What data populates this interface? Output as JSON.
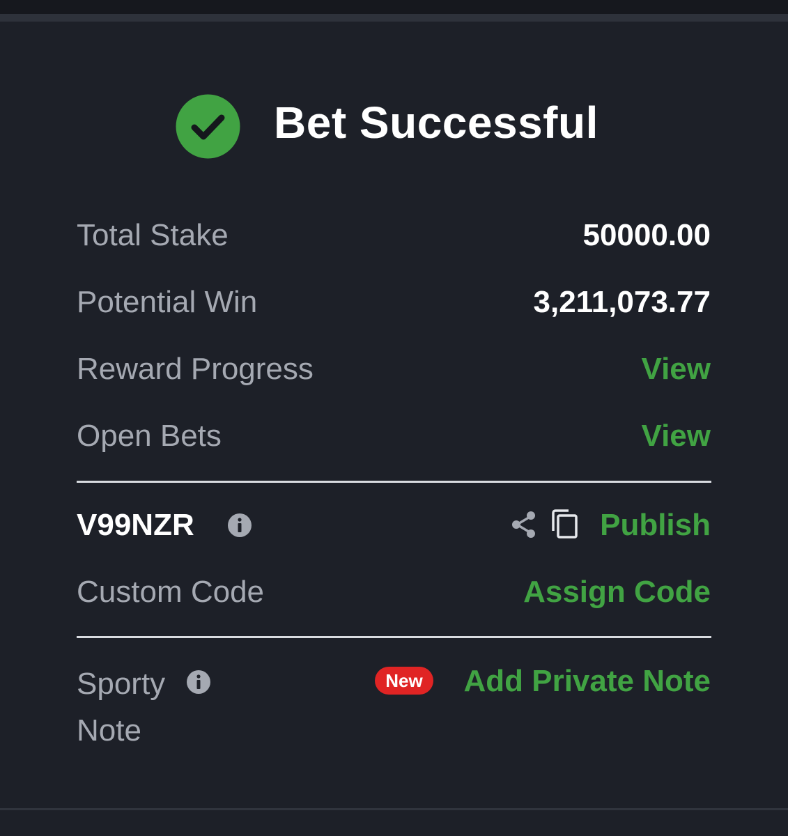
{
  "header": {
    "title": "Bet Successful"
  },
  "summary": {
    "total_stake_label": "Total Stake",
    "total_stake_value": "50000.00",
    "potential_win_label": "Potential Win",
    "potential_win_value": "3,211,073.77",
    "reward_progress_label": "Reward Progress",
    "reward_progress_link": "View",
    "open_bets_label": "Open Bets",
    "open_bets_link": "View"
  },
  "booking": {
    "code": "V99NZR",
    "publish_label": "Publish",
    "custom_code_label": "Custom Code",
    "assign_code_label": "Assign Code"
  },
  "note": {
    "label_line1": "Sporty",
    "label_line2": "Note",
    "badge": "New",
    "add_label": "Add Private Note"
  },
  "colors": {
    "background": "#1d2028",
    "accent_green": "#41a343",
    "badge_red": "#e02424",
    "label_gray": "#a5a9b2"
  },
  "icons": [
    "check-circle-icon",
    "info-icon",
    "share-icon",
    "copy-icon"
  ]
}
